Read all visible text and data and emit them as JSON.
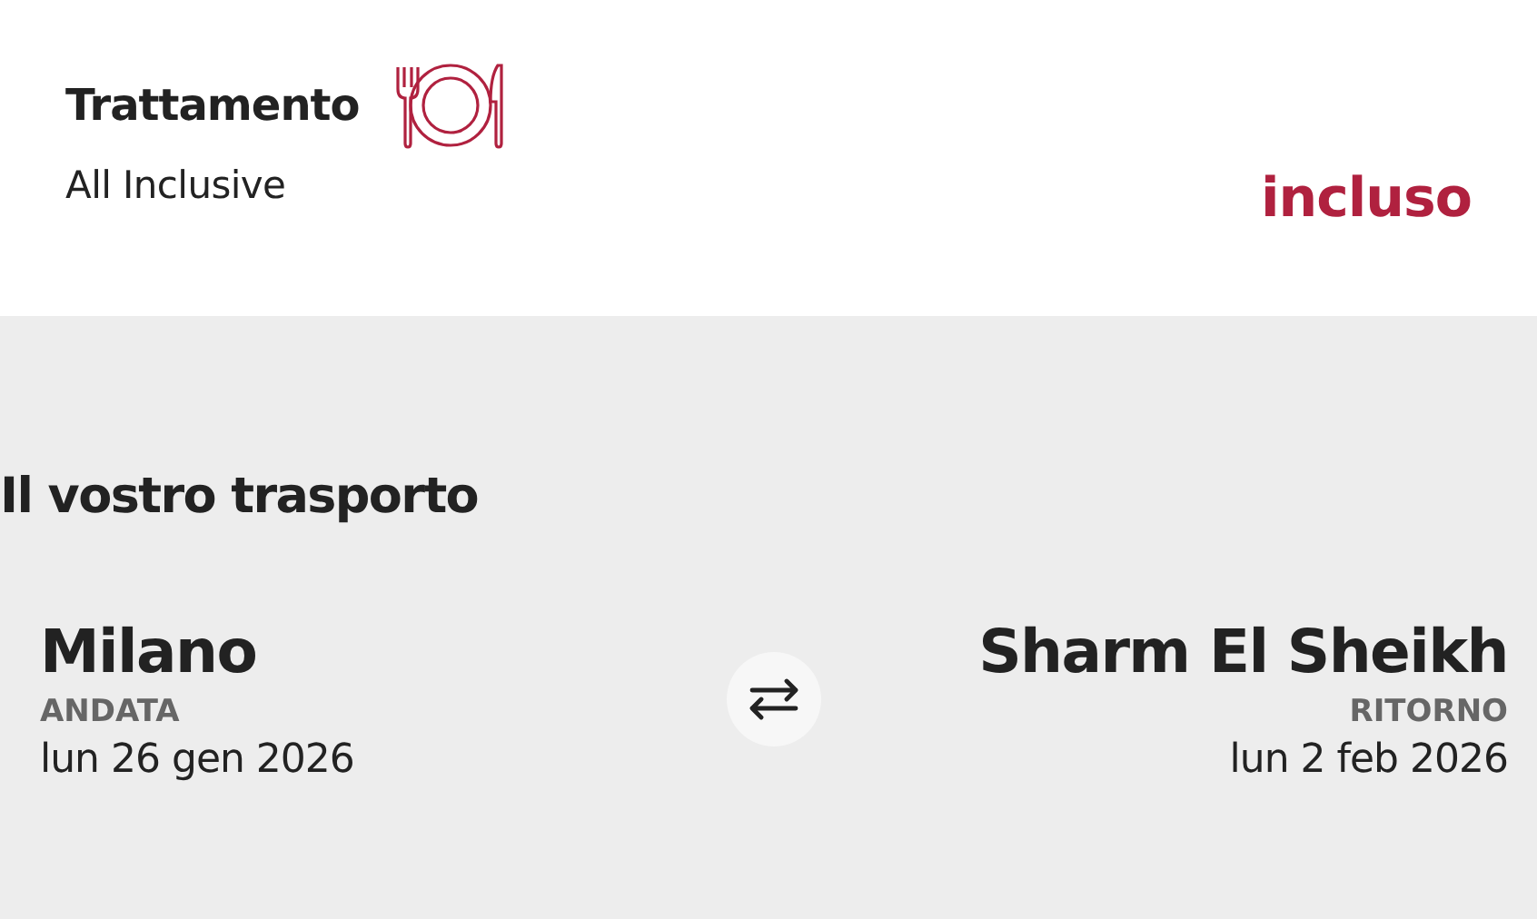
{
  "board": {
    "title": "Trattamento",
    "value": "All Inclusive",
    "price": "incluso"
  },
  "transport": {
    "title": "Il vostro trasporto",
    "outbound": {
      "city": "Milano",
      "label": "ANDATA",
      "date": "lun 26 gen 2026"
    },
    "return": {
      "city": "Sharm El Sheikh",
      "label": "RITORNO",
      "date": "lun 2 feb 2026"
    }
  }
}
